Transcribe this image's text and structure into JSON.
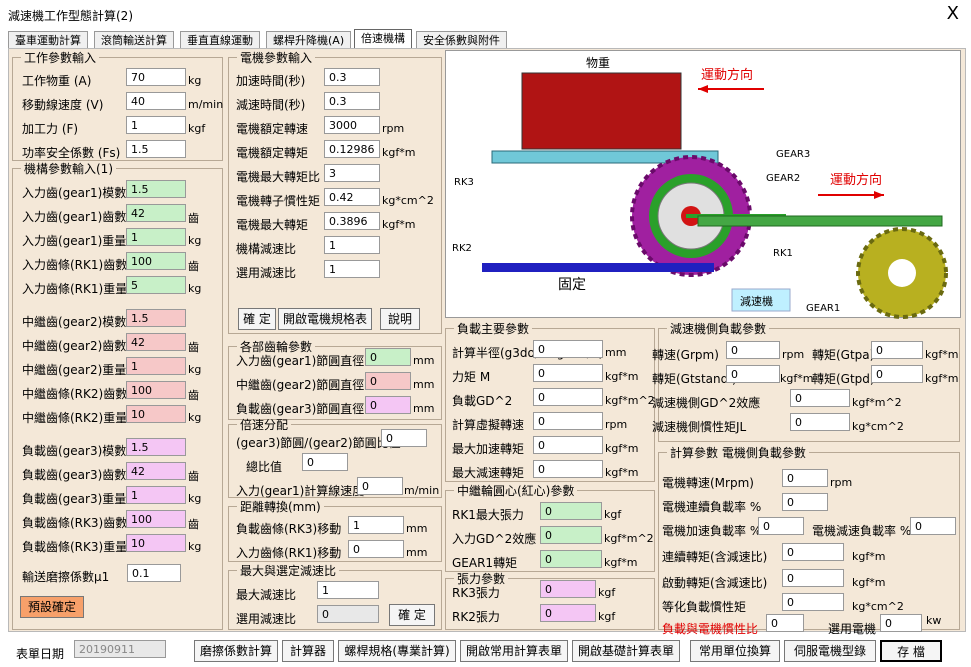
{
  "window": {
    "title": "減速機工作型態計算(2)",
    "close": "X"
  },
  "tabs": [
    "臺車運動計算",
    "滾筒輸送計算",
    "垂直直線運動",
    "螺桿升降機(A)",
    "倍速機構",
    "安全係數與附件"
  ],
  "work": {
    "legend": "工作參數輸入",
    "rows": [
      {
        "label": "工作物重 (A)",
        "value": "70",
        "unit": "kg"
      },
      {
        "label": "移動線速度 (V)",
        "value": "40",
        "unit": "m/min"
      },
      {
        "label": "加工力 (F)",
        "value": "1",
        "unit": "kgf"
      },
      {
        "label": "功率安全係數 (Fs)",
        "value": "1.5",
        "unit": ""
      }
    ]
  },
  "mech": {
    "legend": "機構參數輸入(1)",
    "rows": [
      {
        "label": "入力齒(gear1)模數",
        "value": "1.5",
        "unit": ""
      },
      {
        "label": "入力齒(gear1)齒數",
        "value": "42",
        "unit": "齒"
      },
      {
        "label": "入力齒(gear1)重量",
        "value": "1",
        "unit": "kg"
      },
      {
        "label": "入力齒條(RK1)齒數",
        "value": "100",
        "unit": "齒"
      },
      {
        "label": "入力齒條(RK1)重量",
        "value": "5",
        "unit": "kg"
      },
      {
        "label": "中繼齒(gear2)模數",
        "value": "1.5",
        "unit": ""
      },
      {
        "label": "中繼齒(gear2)齒數",
        "value": "42",
        "unit": "齒"
      },
      {
        "label": "中繼齒(gear2)重量",
        "value": "1",
        "unit": "kg"
      },
      {
        "label": "中繼齒條(RK2)齒數",
        "value": "100",
        "unit": "齒"
      },
      {
        "label": "中繼齒條(RK2)重量",
        "value": "10",
        "unit": "kg"
      },
      {
        "label": "負載齒(gear3)模數",
        "value": "1.5",
        "unit": ""
      },
      {
        "label": "負載齒(gear3)齒數",
        "value": "42",
        "unit": "齒"
      },
      {
        "label": "負載齒(gear3)重量",
        "value": "1",
        "unit": "kg"
      },
      {
        "label": "負載齒條(RK3)齒數",
        "value": "100",
        "unit": "齒"
      },
      {
        "label": "負載齒條(RK3)重量",
        "value": "10",
        "unit": "kg"
      }
    ],
    "friction_label": "輸送磨擦係數μ1",
    "friction_value": "0.1",
    "preset_btn": "預設確定"
  },
  "motor": {
    "legend": "電機參數輸入",
    "rows": [
      {
        "label": "加速時間(秒)",
        "value": "0.3",
        "unit": ""
      },
      {
        "label": "減速時間(秒)",
        "value": "0.3",
        "unit": ""
      },
      {
        "label": "電機額定轉速",
        "value": "3000",
        "unit": "rpm"
      },
      {
        "label": "電機額定轉矩",
        "value": "0.12986",
        "unit": "kgf*m"
      },
      {
        "label": "電機最大轉矩比",
        "value": "3",
        "unit": ""
      },
      {
        "label": "電機轉子慣性矩",
        "value": "0.42",
        "unit": "kg*cm^2"
      },
      {
        "label": "電機最大轉矩",
        "value": "0.3896",
        "unit": "kgf*m"
      },
      {
        "label": "機構減速比",
        "value": "1",
        "unit": ""
      },
      {
        "label": "選用減速比",
        "value": "1",
        "unit": ""
      }
    ],
    "btn_ok": "確 定",
    "btn_spec": "開啟電機規格表",
    "btn_help": "說明"
  },
  "gear_params": {
    "legend": "各部齒輪參數",
    "rows": [
      {
        "label": "入力齒(gear1)節圓直徑",
        "value": "0",
        "unit": "mm"
      },
      {
        "label": "中繼齒(gear2)節圓直徑",
        "value": "0",
        "unit": "mm"
      },
      {
        "label": "負載齒(gear3)節圓直徑",
        "value": "0",
        "unit": "mm"
      }
    ]
  },
  "speed": {
    "legend": "倍速分配",
    "ratio_label": "(gear3)節圓/(gear2)節圓比值",
    "ratio_value": "0",
    "total_label": "總比值",
    "total_value": "0",
    "input_label": "入力(gear1)計算線速度",
    "input_value": "0",
    "input_unit": "m/min"
  },
  "distance": {
    "legend": "距離轉換(mm)",
    "rows": [
      {
        "label": "負載齒條(RK3)移動",
        "value": "1",
        "unit": "mm"
      },
      {
        "label": "入力齒條(RK1)移動",
        "value": "0",
        "unit": "mm"
      }
    ]
  },
  "maxratio": {
    "legend": "最大與選定減速比",
    "max_label": "最大減速比",
    "max_value": "1",
    "sel_label": "選用減速比",
    "sel_value": "0",
    "btn": "確 定"
  },
  "diagram": {
    "weight": "物重",
    "motion1": "運動方向",
    "motion2": "運動方向",
    "gear3": "GEAR3",
    "gear2": "GEAR2",
    "gear1": "GEAR1",
    "rk3": "RK3",
    "rk2": "RK2",
    "rk1": "RK1",
    "fixed": "固定",
    "reducer": "減速機"
  },
  "load": {
    "legend": "負載主要參數",
    "rows": [
      {
        "label": "計算半徑(g3do/2+g2do/2)",
        "value": "0",
        "unit": "mm"
      },
      {
        "label": "力矩 M",
        "value": "0",
        "unit": "kgf*m"
      },
      {
        "label": "負載GD^2",
        "value": "0",
        "unit": "kgf*m^2"
      },
      {
        "label": "計算虛擬轉速",
        "value": "0",
        "unit": "rpm"
      },
      {
        "label": "最大加速轉矩",
        "value": "0",
        "unit": "kgf*m"
      },
      {
        "label": "最大減速轉矩",
        "value": "0",
        "unit": "kgf*m"
      }
    ]
  },
  "relay": {
    "legend": "中繼輪圓心(紅心)參數",
    "rows": [
      {
        "label": "RK1最大張力",
        "value": "0",
        "unit": "kgf"
      },
      {
        "label": "入力GD^2效應",
        "value": "0",
        "unit": "kgf*m^2"
      },
      {
        "label": "GEAR1轉矩",
        "value": "0",
        "unit": "kgf*m"
      }
    ]
  },
  "tension": {
    "legend": "張力參數",
    "rows": [
      {
        "label": "RK3張力",
        "value": "0",
        "unit": "kgf"
      },
      {
        "label": "RK2張力",
        "value": "0",
        "unit": "kgf"
      }
    ]
  },
  "reducer": {
    "legend": "減速機側負載參數",
    "grpm_label": "轉速(Grpm)",
    "grpm_value": "0",
    "grpm_unit": "rpm",
    "gtpa_label": "轉矩(Gtpa)",
    "gtpa_value": "0",
    "gtpa_unit": "kgf*m",
    "gtstand_label": "轉矩(Gtstand )",
    "gtstand_value": "0",
    "gtstand_unit": "kgf*m",
    "gtpd_label": "轉矩(Gtpd)",
    "gtpd_value": "0",
    "gtpd_unit": "kgf*m",
    "gd2_label": "減速機側GD^2效應",
    "gd2_value": "0",
    "gd2_unit": "kgf*m^2",
    "inertia_label": "減速機側慣性矩JL",
    "inertia_value": "0",
    "inertia_unit": "kg*cm^2"
  },
  "motorside": {
    "legend": "計算參數 電機側負載參數",
    "speed_label": "電機轉速(Mrpm)",
    "speed_value": "0",
    "speed_unit": "rpm",
    "cont_label": "電機連續負載率 %",
    "cont_value": "0",
    "acc_label": "電機加速負載率 %",
    "acc_value": "0",
    "dec_label": "電機減速負載率 %",
    "dec_value": "0",
    "ctq_label": "連續轉矩(含減速比)",
    "ctq_value": "0",
    "ctq_unit": "kgf*m",
    "stq_label": "啟動轉矩(含減速比)",
    "stq_value": "0",
    "stq_unit": "kgf*m",
    "eq_label": "等化負載慣性矩",
    "eq_value": "0",
    "eq_unit": "kg*cm^2",
    "ratio_label": "負載與電機慣性比",
    "ratio_value": "0",
    "sel_label": "選用電機",
    "sel_value": "0",
    "sel_unit": "kw"
  },
  "footer": {
    "date_label": "表單日期",
    "date_value": "20190911",
    "buttons": [
      "磨擦係數計算",
      "計算器",
      "螺桿規格(專業計算)",
      "開啟常用計算表單",
      "開啟基礎計算表單",
      "常用單位換算",
      "伺服電機型錄",
      "存 檔"
    ]
  },
  "colors": {
    "panel": "#f4e8d8",
    "green": "#c8f0c8",
    "pink": "#f6c8c8",
    "magenta": "#f4c6f4",
    "orange": "#f7a06a",
    "accent_red": "#e00000"
  }
}
